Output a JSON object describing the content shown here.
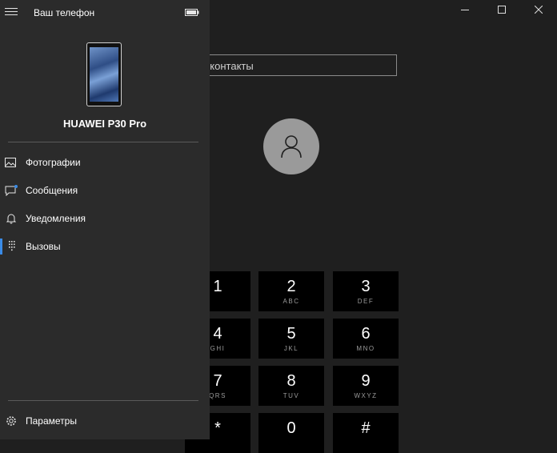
{
  "app": {
    "title": "Ваш телефон"
  },
  "device": {
    "name": "HUAWEI P30 Pro"
  },
  "nav": [
    {
      "label": "Фотографии",
      "icon": "photo-icon"
    },
    {
      "label": "Сообщения",
      "icon": "chat-icon"
    },
    {
      "label": "Уведомления",
      "icon": "bell-icon"
    },
    {
      "label": "Вызовы",
      "icon": "dialpad-icon",
      "selected": true
    }
  ],
  "settings": {
    "label": "Параметры",
    "icon": "gear-icon"
  },
  "search": {
    "text": "ать контакты"
  },
  "dialpad": [
    {
      "digit": "1",
      "letters": ""
    },
    {
      "digit": "2",
      "letters": "ABC"
    },
    {
      "digit": "3",
      "letters": "DEF"
    },
    {
      "digit": "4",
      "letters": "GHI"
    },
    {
      "digit": "5",
      "letters": "JKL"
    },
    {
      "digit": "6",
      "letters": "MNO"
    },
    {
      "digit": "7",
      "letters": "QRS"
    },
    {
      "digit": "8",
      "letters": "TUV"
    },
    {
      "digit": "9",
      "letters": "WXYZ"
    },
    {
      "digit": "*",
      "letters": ""
    },
    {
      "digit": "0",
      "letters": ""
    },
    {
      "digit": "#",
      "letters": ""
    }
  ],
  "colors": {
    "accent": "#3a8be6",
    "pane": "#2b2b2b",
    "background": "#1f1f1f",
    "key": "#000000"
  }
}
